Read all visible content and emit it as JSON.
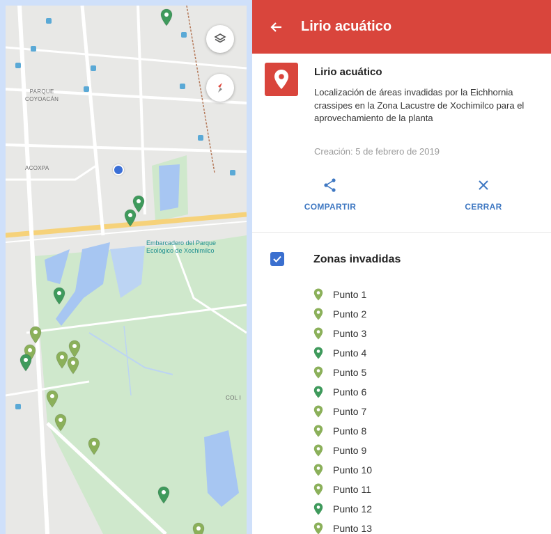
{
  "map": {
    "labels": {
      "area1": "PARQUE\nCOYOACÁN",
      "area2": "ACOXPA",
      "area3": "COL I"
    },
    "poi": "Embarcadero del Parque\nEcológico de Xochimilco",
    "layers_button_icon": "layers-icon",
    "compass_button_icon": "compass-icon",
    "colors": {
      "marker_light": "#8bb05a",
      "marker_dark": "#3f9a5c",
      "water": "#a7c6f2",
      "park": "#c9e5c4"
    }
  },
  "panel": {
    "header": {
      "back_icon": "arrow-left-icon",
      "title": "Lirio acuático",
      "color": "#d9453c"
    },
    "info": {
      "icon": "map-pin-icon",
      "title": "Lirio acuático",
      "description": "Localización de áreas invadidas por la Eichhornia crassipes en la Zona Lacustre de Xochimilco para el aprovechamiento de la planta",
      "created": "Creación: 5 de febrero de 2019"
    },
    "actions": {
      "share": {
        "icon": "share-icon",
        "label": "COMPARTIR"
      },
      "close": {
        "icon": "close-icon",
        "label": "CERRAR"
      }
    },
    "layer": {
      "checked": true,
      "name": "Zonas invadidas",
      "points": [
        {
          "label": "Punto 1",
          "color": "#8bb05a"
        },
        {
          "label": "Punto 2",
          "color": "#8bb05a"
        },
        {
          "label": "Punto 3",
          "color": "#8bb05a"
        },
        {
          "label": "Punto 4",
          "color": "#3f9a5c"
        },
        {
          "label": "Punto 5",
          "color": "#8bb05a"
        },
        {
          "label": "Punto 6",
          "color": "#3f9a5c"
        },
        {
          "label": "Punto 7",
          "color": "#8bb05a"
        },
        {
          "label": "Punto 8",
          "color": "#8bb05a"
        },
        {
          "label": "Punto 9",
          "color": "#8bb05a"
        },
        {
          "label": "Punto 10",
          "color": "#8bb05a"
        },
        {
          "label": "Punto 11",
          "color": "#8bb05a"
        },
        {
          "label": "Punto 12",
          "color": "#3f9a5c"
        },
        {
          "label": "Punto 13",
          "color": "#8bb05a"
        }
      ]
    }
  }
}
